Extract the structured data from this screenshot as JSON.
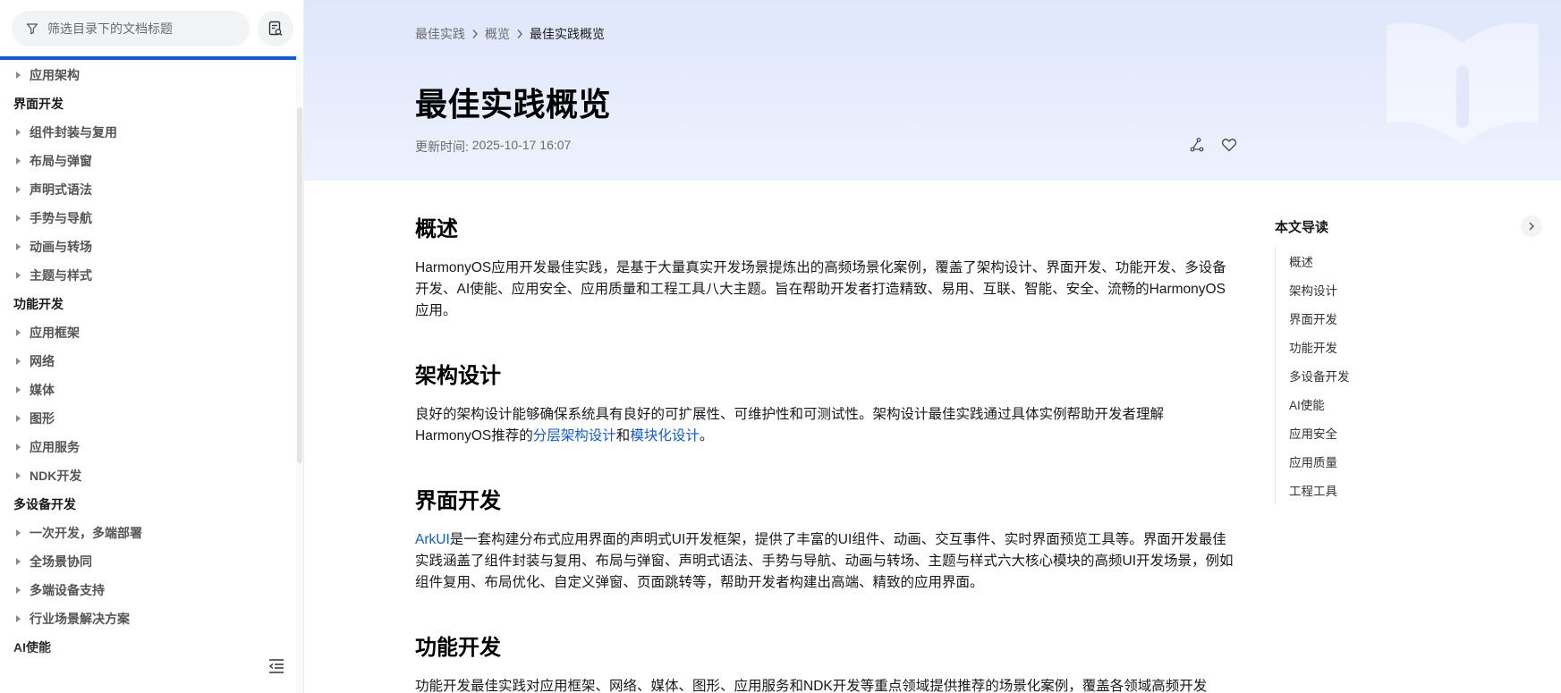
{
  "sidebar": {
    "filter_placeholder": "筛选目录下的文档标题",
    "items": [
      {
        "kind": "item",
        "label": "应用架构"
      },
      {
        "kind": "group",
        "label": "界面开发"
      },
      {
        "kind": "item",
        "label": "组件封装与复用"
      },
      {
        "kind": "item",
        "label": "布局与弹窗"
      },
      {
        "kind": "item",
        "label": "声明式语法"
      },
      {
        "kind": "item",
        "label": "手势与导航"
      },
      {
        "kind": "item",
        "label": "动画与转场"
      },
      {
        "kind": "item",
        "label": "主题与样式"
      },
      {
        "kind": "group",
        "label": "功能开发"
      },
      {
        "kind": "item",
        "label": "应用框架"
      },
      {
        "kind": "item",
        "label": "网络"
      },
      {
        "kind": "item",
        "label": "媒体"
      },
      {
        "kind": "item",
        "label": "图形"
      },
      {
        "kind": "item",
        "label": "应用服务"
      },
      {
        "kind": "item",
        "label": "NDK开发"
      },
      {
        "kind": "group",
        "label": "多设备开发"
      },
      {
        "kind": "item",
        "label": "一次开发，多端部署"
      },
      {
        "kind": "item",
        "label": "全场景协同"
      },
      {
        "kind": "item",
        "label": "多端设备支持"
      },
      {
        "kind": "item",
        "label": "行业场景解决方案"
      },
      {
        "kind": "group",
        "label": "AI使能"
      }
    ]
  },
  "breadcrumb": [
    "最佳实践",
    "概览",
    "最佳实践概览"
  ],
  "page": {
    "title": "最佳实践概览",
    "update_label": "更新时间: ",
    "update_time": "2025-10-17 16:07"
  },
  "article": {
    "overview": {
      "heading": "概述",
      "text": "HarmonyOS应用开发最佳实践，是基于大量真实开发场景提炼出的高频场景化案例，覆盖了架构设计、界面开发、功能开发、多设备开发、AI使能、应用安全、应用质量和工程工具八大主题。旨在帮助开发者打造精致、易用、互联、智能、安全、流畅的HarmonyOS应用。"
    },
    "arch": {
      "heading": "架构设计",
      "text_before": "良好的架构设计能够确保系统具有良好的可扩展性、可维护性和可测试性。架构设计最佳实践通过具体实例帮助开发者理解HarmonyOS推荐的",
      "link1": "分层架构设计",
      "mid": "和",
      "link2": "模块化设计",
      "text_after": "。"
    },
    "ui": {
      "heading": "界面开发",
      "link": "ArkUI",
      "text": "是一套构建分布式应用界面的声明式UI开发框架，提供了丰富的UI组件、动画、交互事件、实时界面预览工具等。界面开发最佳实践涵盖了组件封装与复用、布局与弹窗、声明式语法、手势与导航、动画与转场、主题与样式六大核心模块的高频UI开发场景，例如组件复用、布局优化、自定义弹窗、页面跳转等，帮助开发者构建出高端、精致的应用界面。"
    },
    "func": {
      "heading": "功能开发",
      "text": "功能开发最佳实践对应用框架、网络、媒体、图形、应用服务和NDK开发等重点领域提供推荐的场景化案例，覆盖各领域高频开发"
    }
  },
  "toc": {
    "title": "本文导读",
    "items": [
      "概述",
      "架构设计",
      "界面开发",
      "功能开发",
      "多设备开发",
      "AI使能",
      "应用安全",
      "应用质量",
      "工程工具"
    ]
  },
  "colors": {
    "accent": "#0a59f7",
    "hero_top": "#dfe6fc",
    "hero_bottom": "#eef2fe"
  }
}
